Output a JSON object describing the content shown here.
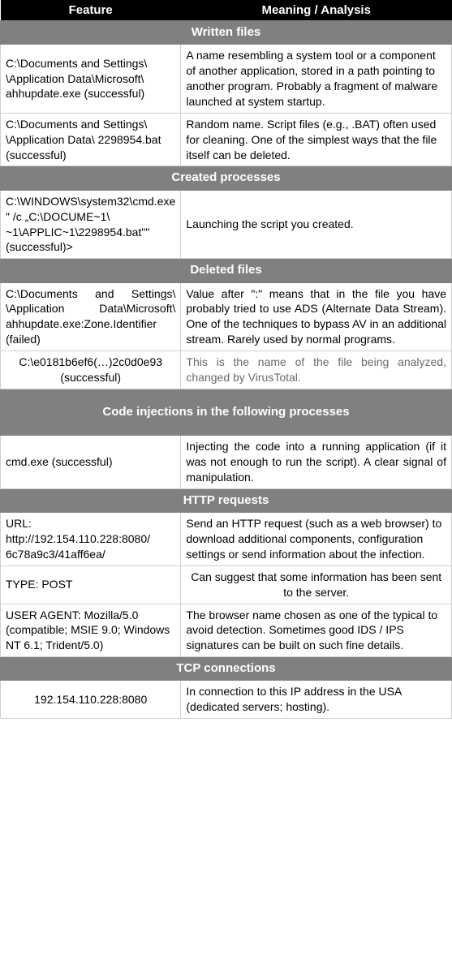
{
  "headers": {
    "feature": "Feature",
    "meaning": "Meaning / Analysis"
  },
  "sections": [
    {
      "title": "Written files",
      "tall": false,
      "rows": [
        {
          "feature": "C:\\Documents and Settings\\ \\Application Data\\Microsoft\\ ahhupdate.exe (successful)",
          "meaning": "A name resembling a system tool or a component of another application, stored in a path pointing to another program. Probably a fragment of malware launched at system startup.",
          "featureClass": "",
          "meaningClass": ""
        },
        {
          "feature": "C:\\Documents and Settings\\ \\Application Data\\ 2298954.bat (successful)",
          "meaning": "Random name. Script files (e.g., .BAT) often used for cleaning. One of the simplest ways that the file itself can be deleted.",
          "featureClass": "",
          "meaningClass": ""
        }
      ]
    },
    {
      "title": "Created processes",
      "tall": false,
      "rows": [
        {
          "feature": "C:\\WINDOWS\\system32\\cmd.exe\" /c „C:\\DOCUME~1\\ ~1\\APPLIC~1\\2298954.bat\"\" (successful)>",
          "meaning": "Launching the script you created.",
          "featureClass": "",
          "meaningClass": ""
        }
      ]
    },
    {
      "title": "Deleted files",
      "tall": false,
      "rows": [
        {
          "feature": "C:\\Documents and Settings\\ \\Application Data\\Microsoft\\ ahhupdate.exe:Zone.Identifier (failed)",
          "meaning": "Value after \":\" means that in the file you have probably tried to use ADS (Alternate Data Stream). One of the techniques to bypass AV in an additional stream. Rarely used by normal programs.",
          "featureClass": "justify",
          "meaningClass": "justify"
        },
        {
          "feature": "C:\\e0181b6ef6(…)2c0d0e93 (successful)",
          "meaning": "This is the name of the file being analyzed, changed by VirusTotal.",
          "featureClass": "center",
          "meaningClass": "justify grey-text"
        }
      ]
    },
    {
      "title": "Code injections in the following processes",
      "tall": true,
      "rows": [
        {
          "feature": "cmd.exe (successful)",
          "meaning": "Injecting the code into a running application (if it was not enough to run the script). A clear signal of manipulation.",
          "featureClass": "",
          "meaningClass": "justify"
        }
      ]
    },
    {
      "title": "HTTP requests",
      "tall": false,
      "rows": [
        {
          "feature": "URL: http://192.154.110.228:8080/ 6c78a9c3/41aff6ea/",
          "meaning": "Send an HTTP request (such as a web browser) to download additional components, configuration settings or send information about the infection.",
          "featureClass": "",
          "meaningClass": ""
        },
        {
          "feature": "TYPE: POST",
          "meaning": "Can suggest that some information has been sent to the server.",
          "featureClass": "",
          "meaningClass": "center"
        },
        {
          "feature": "USER AGENT: Mozilla/5.0 (compatible; MSIE 9.0; Windows NT 6.1; Trident/5.0)",
          "meaning": "The browser name chosen as one of the typical to avoid detection. Sometimes good IDS / IPS signatures can be built on such fine details.",
          "featureClass": "",
          "meaningClass": ""
        }
      ]
    },
    {
      "title": "TCP connections",
      "tall": false,
      "rows": [
        {
          "feature": "192.154.110.228:8080",
          "meaning": "In connection to this IP address in the USA (dedicated servers; hosting).",
          "featureClass": "center",
          "meaningClass": ""
        }
      ]
    }
  ]
}
